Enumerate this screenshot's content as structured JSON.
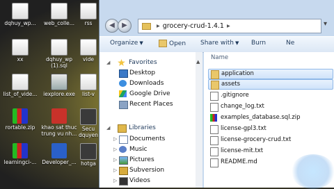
{
  "desktop": {
    "icons": [
      {
        "label": "dqhuy_wp...",
        "icon": "file-icon"
      },
      {
        "label": "web_colle...",
        "icon": "file-icon"
      },
      {
        "label": "rss",
        "icon": "file-icon"
      },
      {
        "label": "xx",
        "icon": "file-icon"
      },
      {
        "label": "dqhuy_wp (1).sql",
        "icon": "sql-file-icon"
      },
      {
        "label": "vide",
        "icon": "file-icon"
      },
      {
        "label": "list_of_vide...",
        "icon": "file-icon"
      },
      {
        "label": "iexplore.exe",
        "icon": "exe-icon"
      },
      {
        "label": "list-v",
        "icon": "file-icon"
      },
      {
        "label": "rortable.zip",
        "icon": "zip-icon"
      },
      {
        "label": "khao sat thuc trung vu nh...",
        "icon": "pdf-icon"
      },
      {
        "label": "Secu dquyen",
        "icon": "app-icon"
      },
      {
        "label": "learningci-...",
        "icon": "zip-icon"
      },
      {
        "label": "Developer_...",
        "icon": "app-icon"
      },
      {
        "label": "hotga",
        "icon": "app-icon"
      }
    ]
  },
  "window": {
    "breadcrumb": {
      "path": "grocery-crud-1.4.1"
    },
    "toolbar": {
      "organize_label": "Organize",
      "open_label": "Open",
      "share_label": "Share with",
      "burn_label": "Burn",
      "newfolder_label": "Ne"
    },
    "nav": {
      "favorites_label": "Favorites",
      "favorites": [
        "Desktop",
        "Downloads",
        "Google Drive",
        "Recent Places"
      ],
      "libraries_label": "Libraries",
      "libraries": [
        "Documents",
        "Music",
        "Pictures",
        "Subversion",
        "Videos"
      ]
    },
    "files": {
      "column_name": "Name",
      "items": [
        {
          "name": "application",
          "type": "folder",
          "selected": true
        },
        {
          "name": "assets",
          "type": "folder",
          "selected": true
        },
        {
          "name": ".gitignore",
          "type": "file",
          "selected": false
        },
        {
          "name": "change_log.txt",
          "type": "text",
          "selected": false
        },
        {
          "name": "examples_database.sql.zip",
          "type": "zip",
          "selected": false
        },
        {
          "name": "license-gpl3.txt",
          "type": "text",
          "selected": false
        },
        {
          "name": "license-grocery-crud.txt",
          "type": "text",
          "selected": false
        },
        {
          "name": "license-mit.txt",
          "type": "text",
          "selected": false
        },
        {
          "name": "README.md",
          "type": "file",
          "selected": false
        }
      ]
    }
  }
}
